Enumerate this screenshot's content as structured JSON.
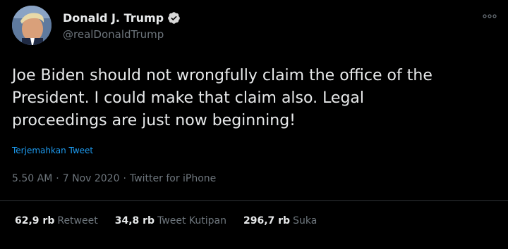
{
  "author": {
    "display_name": "Donald J. Trump",
    "handle": "@realDonaldTrump",
    "verified": true,
    "verified_color": "#d9d9d9"
  },
  "tweet": {
    "text": "Joe Biden should not wrongfully claim the office of the\nPresident. I could make that claim also. Legal\nproceedings are just now beginning!",
    "translate_label": "Terjemahkan Tweet",
    "time": "5.50 AM",
    "date": "7 Nov 2020",
    "source": "Twitter for iPhone",
    "separator": "·"
  },
  "stats": {
    "retweets_value": "62,9 rb",
    "retweets_label": "Retweet",
    "quotes_value": "34,8 rb",
    "quotes_label": "Tweet Kutipan",
    "likes_value": "296,7 rb",
    "likes_label": "Suka"
  },
  "colors": {
    "background": "#000000",
    "text_primary": "#e7e9ea",
    "text_secondary": "#6e767d",
    "link": "#1d9bf0",
    "divider": "#2f3336"
  },
  "icons": {
    "verified": "verified-badge-icon",
    "more": "more-options-icon"
  }
}
